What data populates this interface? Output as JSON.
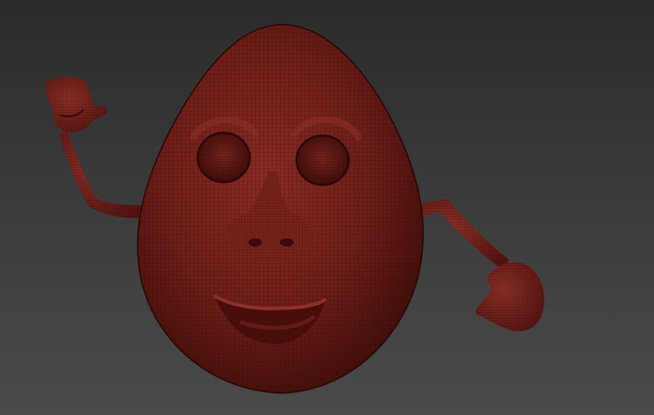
{
  "viewport": {
    "background_top": "#2b2b2b",
    "background_bottom": "#4a4a4a"
  },
  "model": {
    "base_color": "#6e1e18",
    "wire_color": "#2a0705",
    "highlight_color": "#9a3a30"
  }
}
